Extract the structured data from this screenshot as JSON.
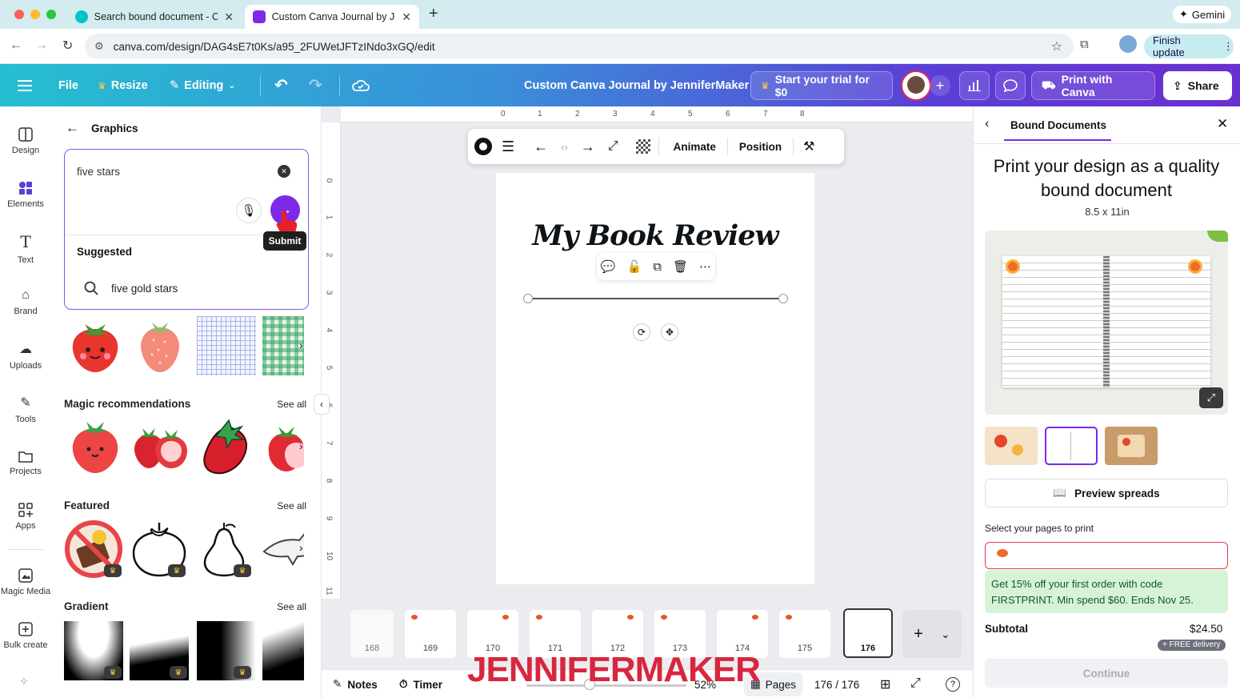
{
  "browser": {
    "tabs": [
      {
        "title": "Search bound document - Ca"
      },
      {
        "title": "Custom Canva Journal by Jer"
      }
    ],
    "url": "canva.com/design/DAG4sE7t0Ks/a95_2FUWetJFTzINdo3xGQ/edit",
    "gemini_label": "Gemini",
    "finish_update_label": "Finish update"
  },
  "toolbar": {
    "file": "File",
    "resize": "Resize",
    "editing": "Editing",
    "doc_title": "Custom Canva Journal by JenniferMaker",
    "trial": "Start your trial for $0",
    "print": "Print with Canva",
    "share": "Share"
  },
  "rail": {
    "items": [
      {
        "label": "Design"
      },
      {
        "label": "Elements"
      },
      {
        "label": "Text"
      },
      {
        "label": "Brand"
      },
      {
        "label": "Uploads"
      },
      {
        "label": "Tools"
      },
      {
        "label": "Projects"
      },
      {
        "label": "Apps"
      },
      {
        "label": "Magic Media"
      },
      {
        "label": "Bulk create"
      }
    ]
  },
  "panel": {
    "title": "Graphics",
    "search_value": "five stars",
    "submit_tooltip": "Submit",
    "suggested_label": "Suggested",
    "suggestion": "five gold stars",
    "sections": {
      "magic": "Magic recommendations",
      "featured": "Featured",
      "gradient": "Gradient",
      "see_all": "See all"
    }
  },
  "canvas": {
    "ruler_top": [
      "0",
      "1",
      "2",
      "3",
      "4",
      "5",
      "6",
      "7",
      "8"
    ],
    "ruler_left": [
      "0",
      "1",
      "2",
      "3",
      "4",
      "5",
      "6",
      "7",
      "8",
      "9",
      "10",
      "11"
    ],
    "float_toolbar": {
      "animate": "Animate",
      "position": "Position"
    },
    "page_heading": "My Book Review"
  },
  "pages_strip": {
    "pages": [
      "168",
      "169",
      "170",
      "171",
      "172",
      "173",
      "174",
      "175",
      "176"
    ],
    "selected": "176"
  },
  "footer": {
    "notes": "Notes",
    "timer": "Timer",
    "zoom": "52%",
    "pages": "Pages",
    "page_count": "176 / 176",
    "watermark": "JENNIFERMAKER"
  },
  "right_panel": {
    "tab": "Bound Documents",
    "heading": "Print your design as a quality bound document",
    "size": "8.5 x 11in",
    "preview_spreads": "Preview spreads",
    "select_pages": "Select your pages to print",
    "promo": "Get 15% off your first order with code FIRSTPRINT. Min spend $60. Ends Nov 25.",
    "subtotal_label": "Subtotal",
    "subtotal_value": "$24.50",
    "free_delivery": "+ FREE delivery",
    "continue": "Continue"
  },
  "colors": {
    "accent_purple": "#7d2ae8",
    "teal": "#25bfd0",
    "promo_bg": "#d6f3d8"
  }
}
